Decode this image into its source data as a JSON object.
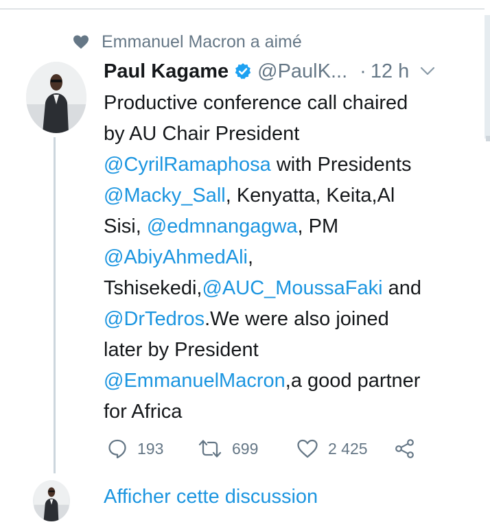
{
  "liked_by": {
    "icon": "heart-icon",
    "text": "Emmanuel Macron a aimé"
  },
  "tweet": {
    "author_name": "Paul Kagame",
    "handle": "@PaulK...",
    "separator": "·",
    "time": "12 h",
    "verified": true,
    "lines": [
      [
        {
          "t": "Productive conference call chaired",
          "m": false
        }
      ],
      [
        {
          "t": "by AU Chair President",
          "m": false
        }
      ],
      [
        {
          "t": "@CyrilRamaphosa",
          "m": true
        },
        {
          "t": " with Presidents",
          "m": false
        }
      ],
      [
        {
          "t": "@Macky_Sall",
          "m": true
        },
        {
          "t": ", Kenyatta, Keita,Al",
          "m": false
        }
      ],
      [
        {
          "t": "Sisi, ",
          "m": false
        },
        {
          "t": "@edmnangagwa",
          "m": true
        },
        {
          "t": ", PM",
          "m": false
        }
      ],
      [
        {
          "t": "@AbiyAhmedAli",
          "m": true
        },
        {
          "t": ",",
          "m": false
        }
      ],
      [
        {
          "t": "Tshisekedi,",
          "m": false
        },
        {
          "t": "@AUC_MoussaFaki",
          "m": true
        },
        {
          "t": " and",
          "m": false
        }
      ],
      [
        {
          "t": "@DrTedros",
          "m": true
        },
        {
          "t": ".We were also joined",
          "m": false
        }
      ],
      [
        {
          "t": "later by President",
          "m": false
        }
      ],
      [
        {
          "t": "@EmmanuelMacron",
          "m": true
        },
        {
          "t": ",a good partner",
          "m": false
        }
      ],
      [
        {
          "t": "for Africa",
          "m": false
        }
      ]
    ],
    "actions": {
      "replies": "193",
      "retweets": "699",
      "likes": "2 425"
    }
  },
  "show_thread_label": "Afficher cette discussion",
  "colors": {
    "link": "#1b95e0",
    "muted": "#657786",
    "text": "#14171a",
    "verified": "#1da1f2"
  }
}
